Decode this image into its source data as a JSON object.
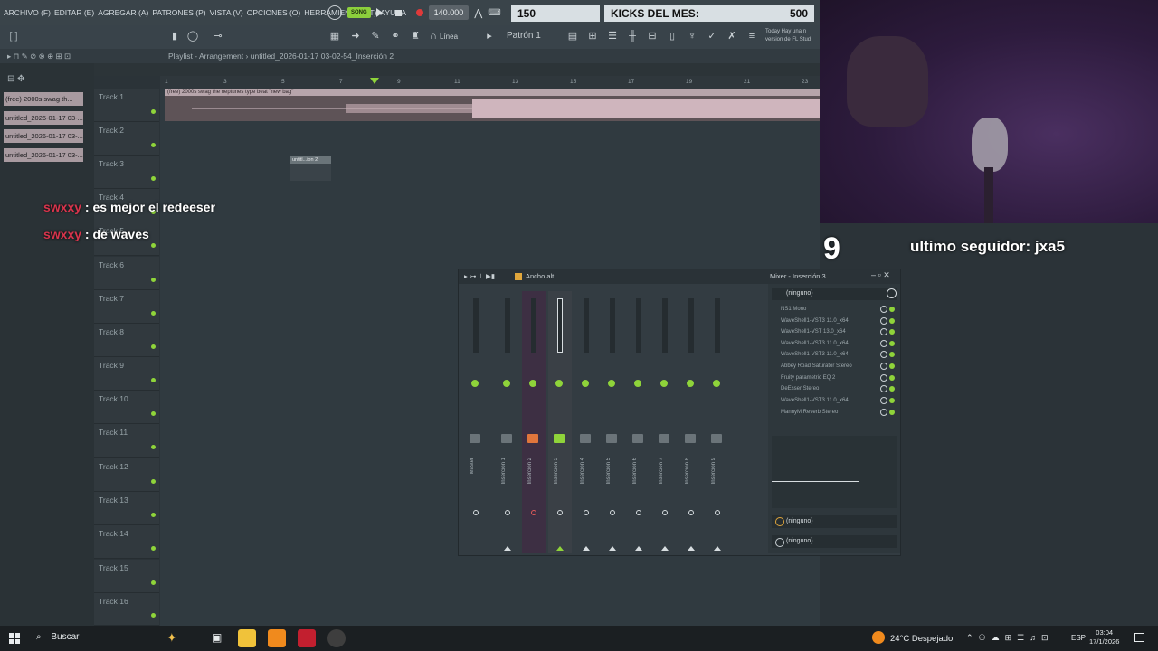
{
  "menu": {
    "items": [
      "ARCHIVO (F)",
      "EDITAR (E)",
      "AGREGAR (A)",
      "PATRONES (P)",
      "VISTA (V)",
      "OPCIONES (O)",
      "HERRAMIENTAS (T)",
      "AYUDA"
    ]
  },
  "toolbar": {
    "song_label": "SONG",
    "tempo": "140.000",
    "counter_left": "150",
    "kicks_label": "KICKS DEL MES:",
    "kicks_value": "500",
    "pattern": "Patrón 1",
    "line_mode": "Línea",
    "news_line1": "Today Hay una n",
    "news_line2": "version de FL Stud"
  },
  "playlist": {
    "header_title": "Playlist - Arrangement",
    "header_path": "untitled_2026-01-17 03-02-54_Inserción 2",
    "ruler": [
      "1",
      "3",
      "5",
      "7",
      "9",
      "11",
      "13",
      "15",
      "17",
      "19",
      "21",
      "23"
    ],
    "patterns": [
      "(free) 2000s swag th...",
      "untitled_2026-01-17 03-...",
      "untitled_2026-01-17 03-...",
      "untitled_2026-01-17 03-..."
    ],
    "tracks": [
      "Track 1",
      "Track 2",
      "Track 3",
      "Track 4",
      "Track 5",
      "Track 6",
      "Track 7",
      "Track 8",
      "Track 9",
      "Track 10",
      "Track 11",
      "Track 12",
      "Track 13",
      "Track 14",
      "Track 15",
      "Track 16"
    ],
    "clip1_label": "(free) 2000s swag  the neptunes type beat  \"new bag\"",
    "clip2_label": "untitl...ion 2"
  },
  "chat": [
    {
      "user": "swxxy",
      "message": "es mejor el redeeser"
    },
    {
      "user": "swxxy",
      "message": "de waves"
    }
  ],
  "overlay": {
    "number": "9",
    "follower_text": "ultimo seguidor: jxa5"
  },
  "mixer": {
    "toolbar_label": "Ancho alt",
    "title": "Mixer - Inserción 3",
    "strips": [
      "Master",
      "Inserción 1",
      "Inserción 2",
      "Inserción 3",
      "Inserción 4",
      "Inserción 5",
      "Inserción 6",
      "Inserción 7",
      "Inserción 8",
      "Inserción 9"
    ],
    "input_select": "(ninguno)",
    "fx_chain": [
      "NS1 Mono",
      "WaveShell1-VST3 11.0_x64",
      "WaveShell1-VST 13.0_x64",
      "WaveShell1-VST3 11.0_x64",
      "WaveShell1-VST3 11.0_x64",
      "Abbey Road Saturator Stereo",
      "Fruity parametric EQ 2",
      "DeEsser Stereo",
      "WaveShell1-VST3 11.0_x64",
      "MannyM Reverb Stereo"
    ],
    "output_select_1": "(ninguno)",
    "output_select_2": "(ninguno)"
  },
  "taskbar": {
    "search": "Buscar",
    "weather": "24°C  Despejado",
    "lang": "ESP",
    "time": "03:04",
    "date": "17/1/2026"
  }
}
